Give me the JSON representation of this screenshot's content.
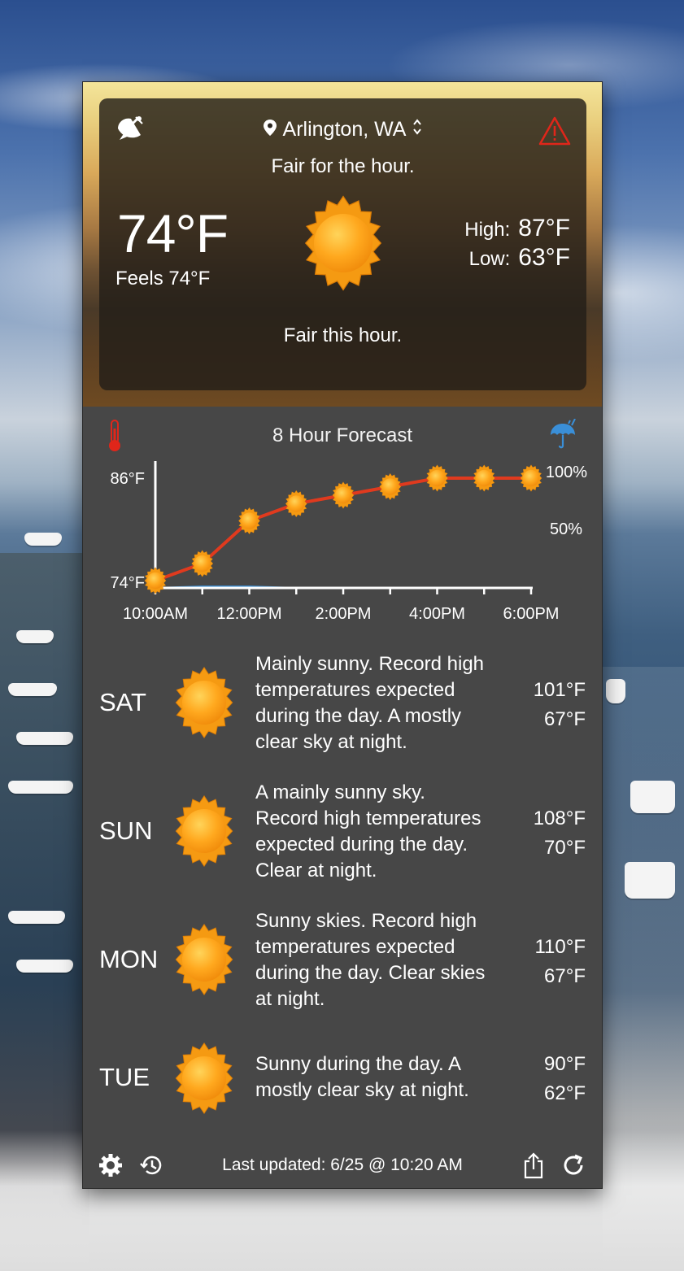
{
  "header": {
    "location": "Arlington, WA",
    "summary_hour": "Fair for the hour.",
    "current_temp": "74°F",
    "feels_like": "Feels 74°F",
    "high_label": "High:",
    "high_value": "87°F",
    "low_label": "Low:",
    "low_value": "63°F",
    "summary_bottom": "Fair this hour.",
    "icons": {
      "radar": "satellite-dish-icon",
      "location": "location-pin-icon",
      "switch": "up-down-chevron-icon",
      "alert": "warning-triangle-icon",
      "condition": "sun-icon"
    }
  },
  "forecast": {
    "title": "8 Hour Forecast",
    "icons": {
      "temperature": "thermometer-icon",
      "precipitation": "umbrella-rain-icon"
    }
  },
  "chart_data": {
    "type": "line",
    "x": [
      "10:00AM",
      "11:00AM",
      "12:00PM",
      "1:00PM",
      "2:00PM",
      "3:00PM",
      "4:00PM",
      "5:00PM",
      "6:00PM"
    ],
    "x_tick_labels": [
      "10:00AM",
      "12:00PM",
      "2:00PM",
      "4:00PM",
      "6:00PM"
    ],
    "series": [
      {
        "values": [
          74,
          76,
          81,
          83,
          84,
          85,
          86,
          86,
          86
        ],
        "color": "#e03a1e"
      },
      {
        "values": [
          0,
          1,
          1,
          0,
          0,
          0,
          0,
          0,
          0
        ],
        "color": "#3a8fd8"
      }
    ],
    "y_labels_left": [
      "86°F",
      "74°F"
    ],
    "y_labels_right": [
      "100%",
      "50%"
    ],
    "ylim": [
      74,
      86
    ],
    "point_icon": "sun-icon"
  },
  "days": [
    {
      "name": "SAT",
      "desc_lines": [
        "Mainly sunny. Record high",
        "temperatures expected",
        "during the day. A mostly",
        "clear sky at night."
      ],
      "high": "101°F",
      "low": "67°F",
      "icon": "sun-icon"
    },
    {
      "name": "SUN",
      "desc_lines": [
        "A mainly sunny sky.",
        "Record high temperatures",
        "expected during the day.",
        "Clear at night."
      ],
      "high": "108°F",
      "low": "70°F",
      "icon": "sun-icon"
    },
    {
      "name": "MON",
      "desc_lines": [
        "Sunny skies. Record high",
        "temperatures expected",
        "during the day. Clear skies",
        "at night."
      ],
      "high": "110°F",
      "low": "67°F",
      "icon": "sun-icon"
    },
    {
      "name": "TUE",
      "desc_lines": [
        "Sunny during the day. A",
        "mostly clear sky at night."
      ],
      "high": "90°F",
      "low": "62°F",
      "icon": "sun-icon"
    }
  ],
  "footer": {
    "last_updated": "Last updated: 6/25 @ 10:20 AM",
    "icons": {
      "settings": "gear-icon",
      "history": "history-icon",
      "share": "share-icon",
      "refresh": "refresh-icon"
    }
  }
}
